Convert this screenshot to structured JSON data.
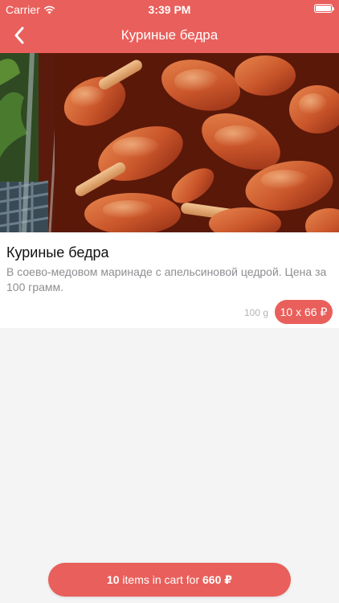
{
  "status_bar": {
    "carrier": "Carrier",
    "time": "3:39 PM",
    "wifi_icon": "wifi-icon",
    "battery_icon": "battery-icon"
  },
  "nav": {
    "title": "Куриные бедра",
    "back_icon": "chevron-left-icon"
  },
  "product": {
    "name": "Куриные бедра",
    "description": "В соево-медовом маринаде с апельсиновой цедрой. Цена за 100 грамм.",
    "weight": "100 g",
    "price_label": "10 x 66 ₽"
  },
  "cart": {
    "count": "10",
    "middle": " items in cart for ",
    "total": "660 ₽"
  },
  "colors": {
    "accent": "#e95f5b",
    "background": "#f4f4f4"
  }
}
